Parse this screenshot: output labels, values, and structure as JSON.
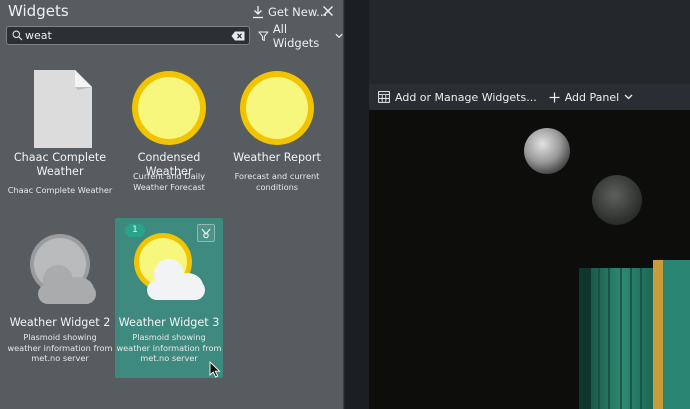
{
  "panel": {
    "title": "Widgets",
    "get_new_label": "Get New...",
    "search": {
      "value": "weat",
      "placeholder": ""
    },
    "filter_label": "All Widgets",
    "widgets": [
      {
        "name": "Chaac Complete Weather",
        "description": "Chaac Complete Weather",
        "icon": "document-icon"
      },
      {
        "name": "Condensed Weather",
        "description": "Current and Daily Weather Forecast",
        "icon": "sun-icon"
      },
      {
        "name": "Weather Report",
        "description": "Forecast and current conditions",
        "icon": "sun-icon"
      },
      {
        "name": "Weather Widget 2",
        "description": "Plasmoid showing weather information from met.no server",
        "icon": "cloud-icon"
      },
      {
        "name": "Weather Widget 3",
        "description": "Plasmoid showing weather information from met.no server",
        "icon": "sun-cloud-icon",
        "instance_count": "1",
        "selected": true
      }
    ]
  },
  "toolbar": {
    "manage_label": "Add or Manage Widgets...",
    "add_panel_label": "Add Panel"
  },
  "colors": {
    "panel_bg": "#575c60",
    "selected_tile": "#3e8a7e",
    "badge": "#2aa38b",
    "sun_yellow": "#f5f57a",
    "sun_ring": "#f2c400"
  }
}
